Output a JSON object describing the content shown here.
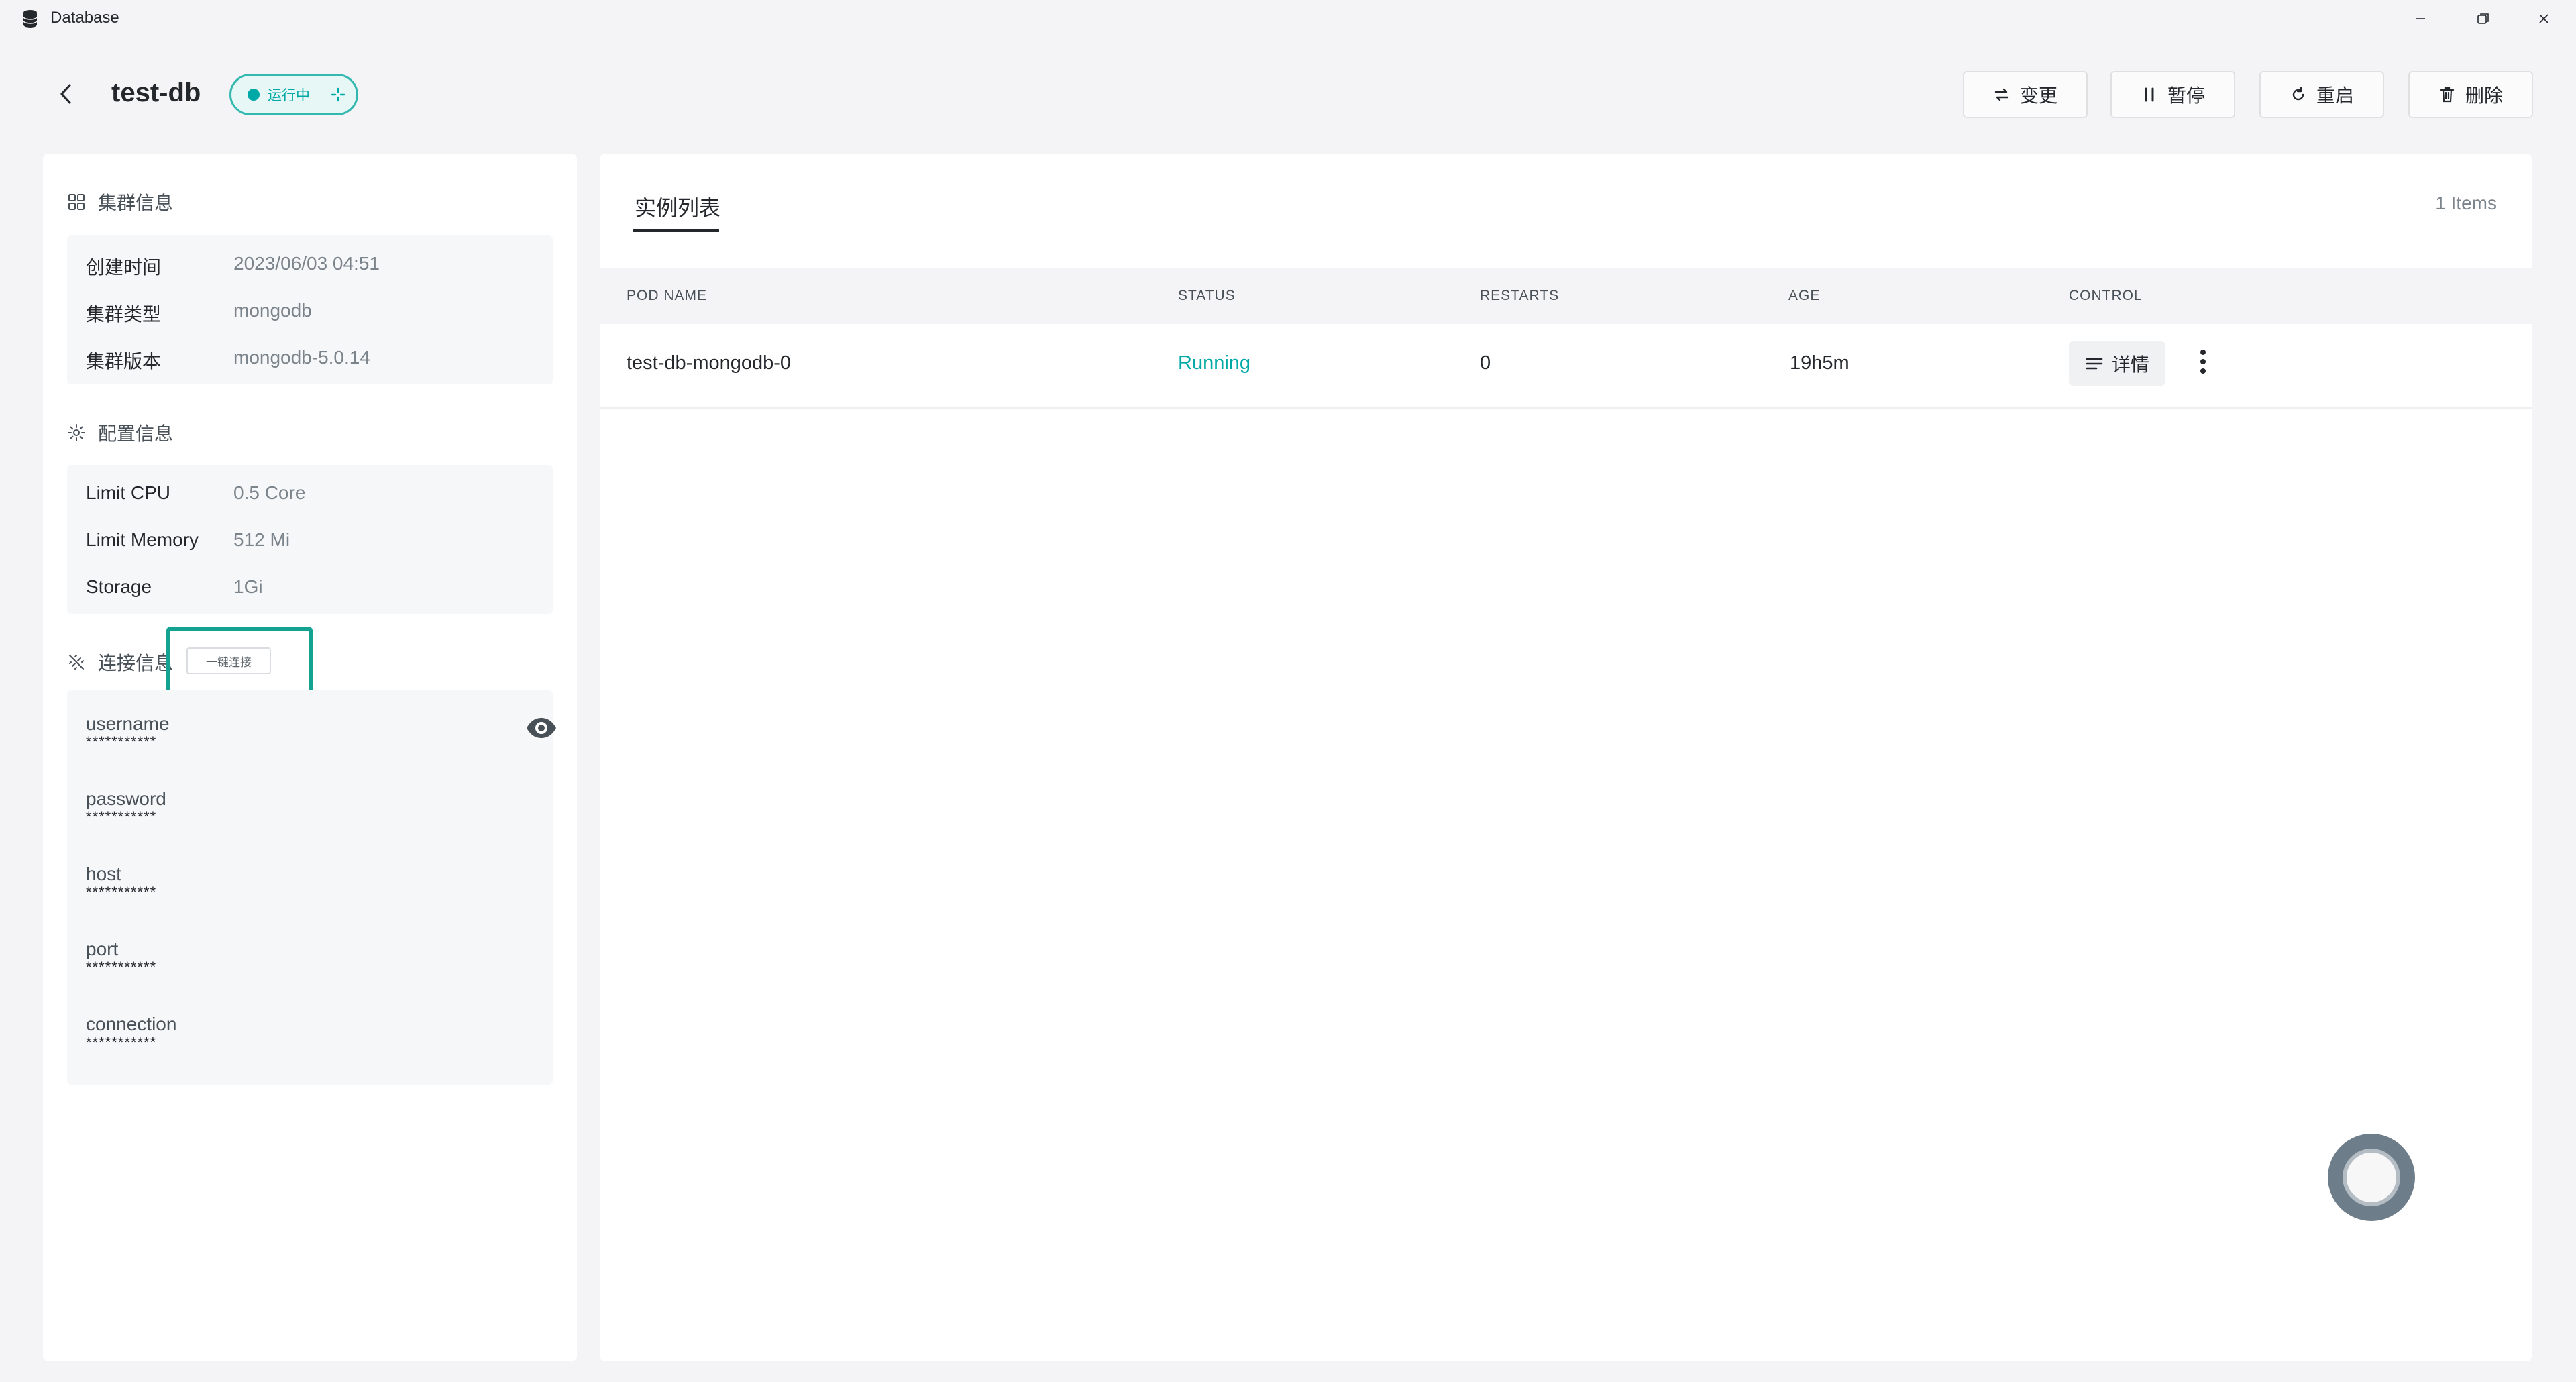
{
  "window": {
    "title": "Database"
  },
  "header": {
    "db_name": "test-db",
    "status": "运行中",
    "actions": {
      "change": "变更",
      "pause": "暂停",
      "restart": "重启",
      "delete": "删除"
    }
  },
  "cluster_info": {
    "title": "集群信息",
    "rows": [
      {
        "key": "创建时间",
        "value": "2023/06/03 04:51"
      },
      {
        "key": "集群类型",
        "value": "mongodb"
      },
      {
        "key": "集群版本",
        "value": "mongodb-5.0.14"
      }
    ]
  },
  "config_info": {
    "title": "配置信息",
    "rows": [
      {
        "key": "Limit CPU",
        "value": "0.5 Core"
      },
      {
        "key": "Limit Memory",
        "value": "512 Mi"
      },
      {
        "key": "Storage",
        "value": "1Gi"
      }
    ]
  },
  "connection_info": {
    "title": "连接信息",
    "quick_connect": "一键连接",
    "fields": [
      {
        "label": "username",
        "value": "***********"
      },
      {
        "label": "password",
        "value": "***********"
      },
      {
        "label": "host",
        "value": "***********"
      },
      {
        "label": "port",
        "value": "***********"
      },
      {
        "label": "connection",
        "value": "***********"
      }
    ]
  },
  "instances": {
    "tab": "实例列表",
    "count": "1 Items",
    "columns": [
      "POD NAME",
      "STATUS",
      "RESTARTS",
      "AGE",
      "CONTROL"
    ],
    "rows": [
      {
        "pod_name": "test-db-mongodb-0",
        "status": "Running",
        "restarts": "0",
        "age": "19h5m",
        "detail": "详情"
      }
    ]
  },
  "colors": {
    "accent": "#00a9a6",
    "highlight": "#14a393"
  }
}
